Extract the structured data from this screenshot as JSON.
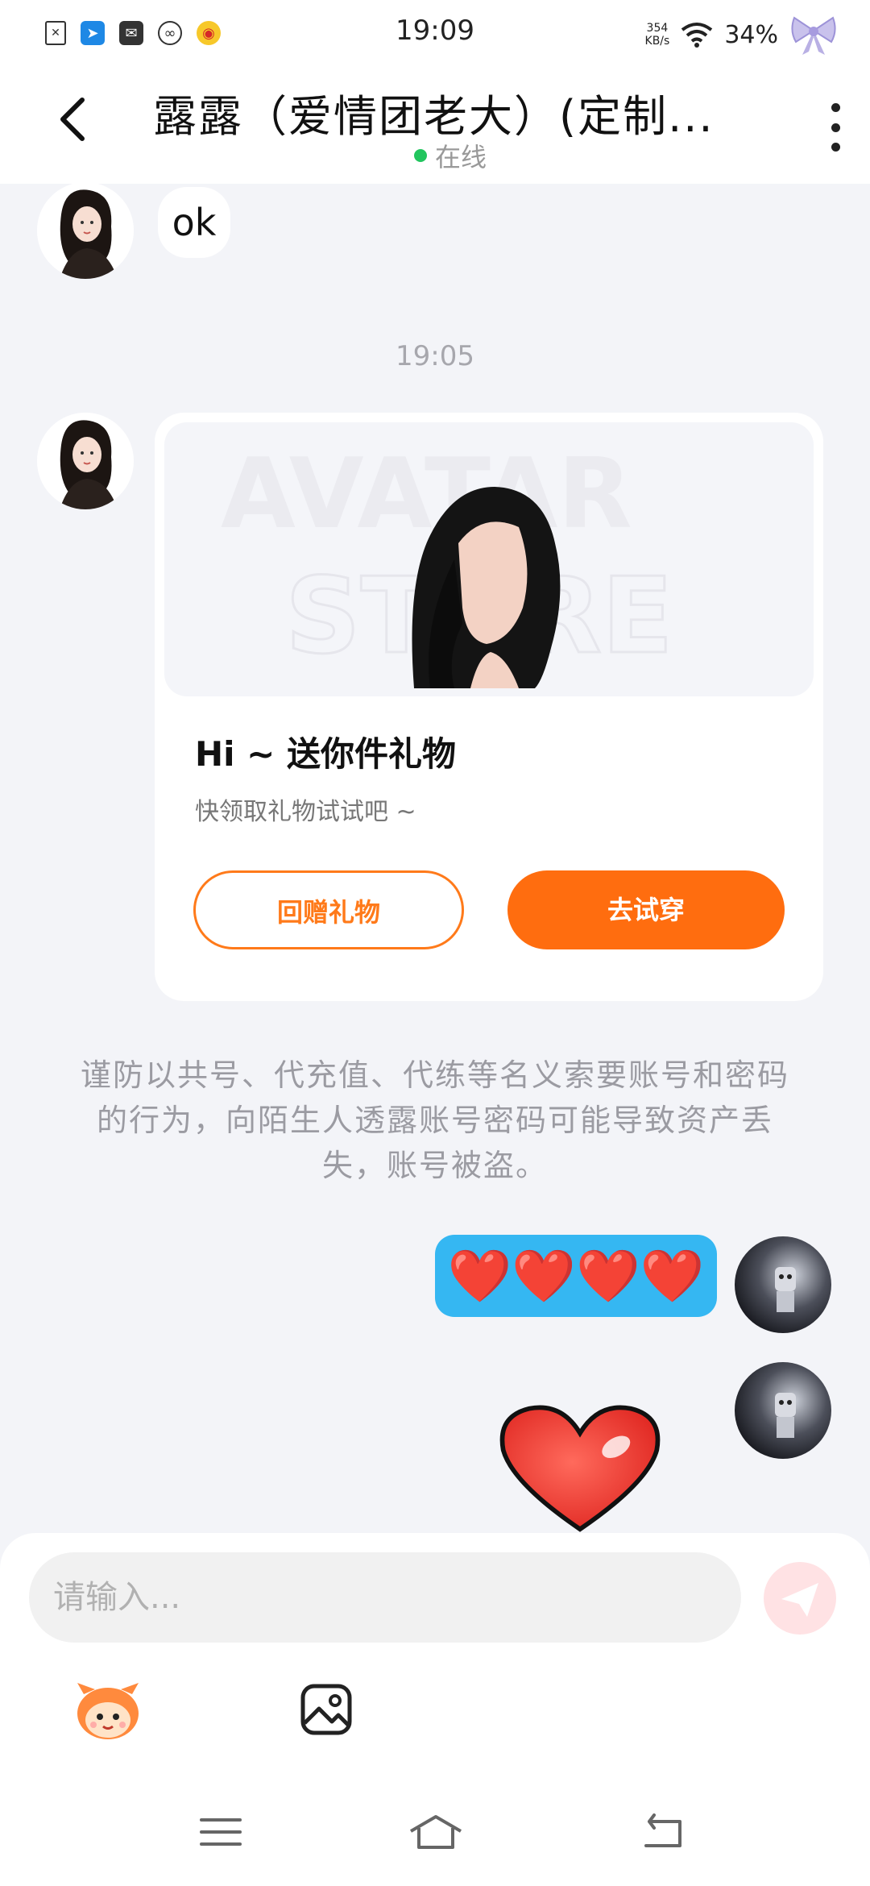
{
  "status_bar": {
    "time": "19:09",
    "net_speed_value": "354",
    "net_speed_unit": "KB/s",
    "battery": "34%",
    "icons": [
      "file-x-icon",
      "feishu-icon",
      "mail-icon",
      "link-icon",
      "weibo-icon"
    ]
  },
  "header": {
    "title": "露露（爱情团老大）(定制...",
    "status": "在线",
    "status_color": "#22c55e"
  },
  "messages": {
    "incoming_text": "ok",
    "timestamp": "19:05",
    "gift_card": {
      "watermark_line1": "AVATAR",
      "watermark_line2": "STORE",
      "title": "Hi ~ 送你件礼物",
      "subtitle": "快领取礼物试试吧 ~",
      "return_gift_label": "回赠礼物",
      "try_on_label": "去试穿"
    },
    "warning": "谨防以共号、代充值、代练等名义索要账号和密码的行为，向陌生人透露账号密码可能导致资产丢失，账号被盗。",
    "outgoing_emoji": "❤️❤️❤️❤️",
    "outgoing_sticker": "red-heart-sticker"
  },
  "input": {
    "placeholder": "请输入..."
  },
  "colors": {
    "accent_orange": "#ff6d0f",
    "outgoing_bubble": "#35b7f2"
  }
}
